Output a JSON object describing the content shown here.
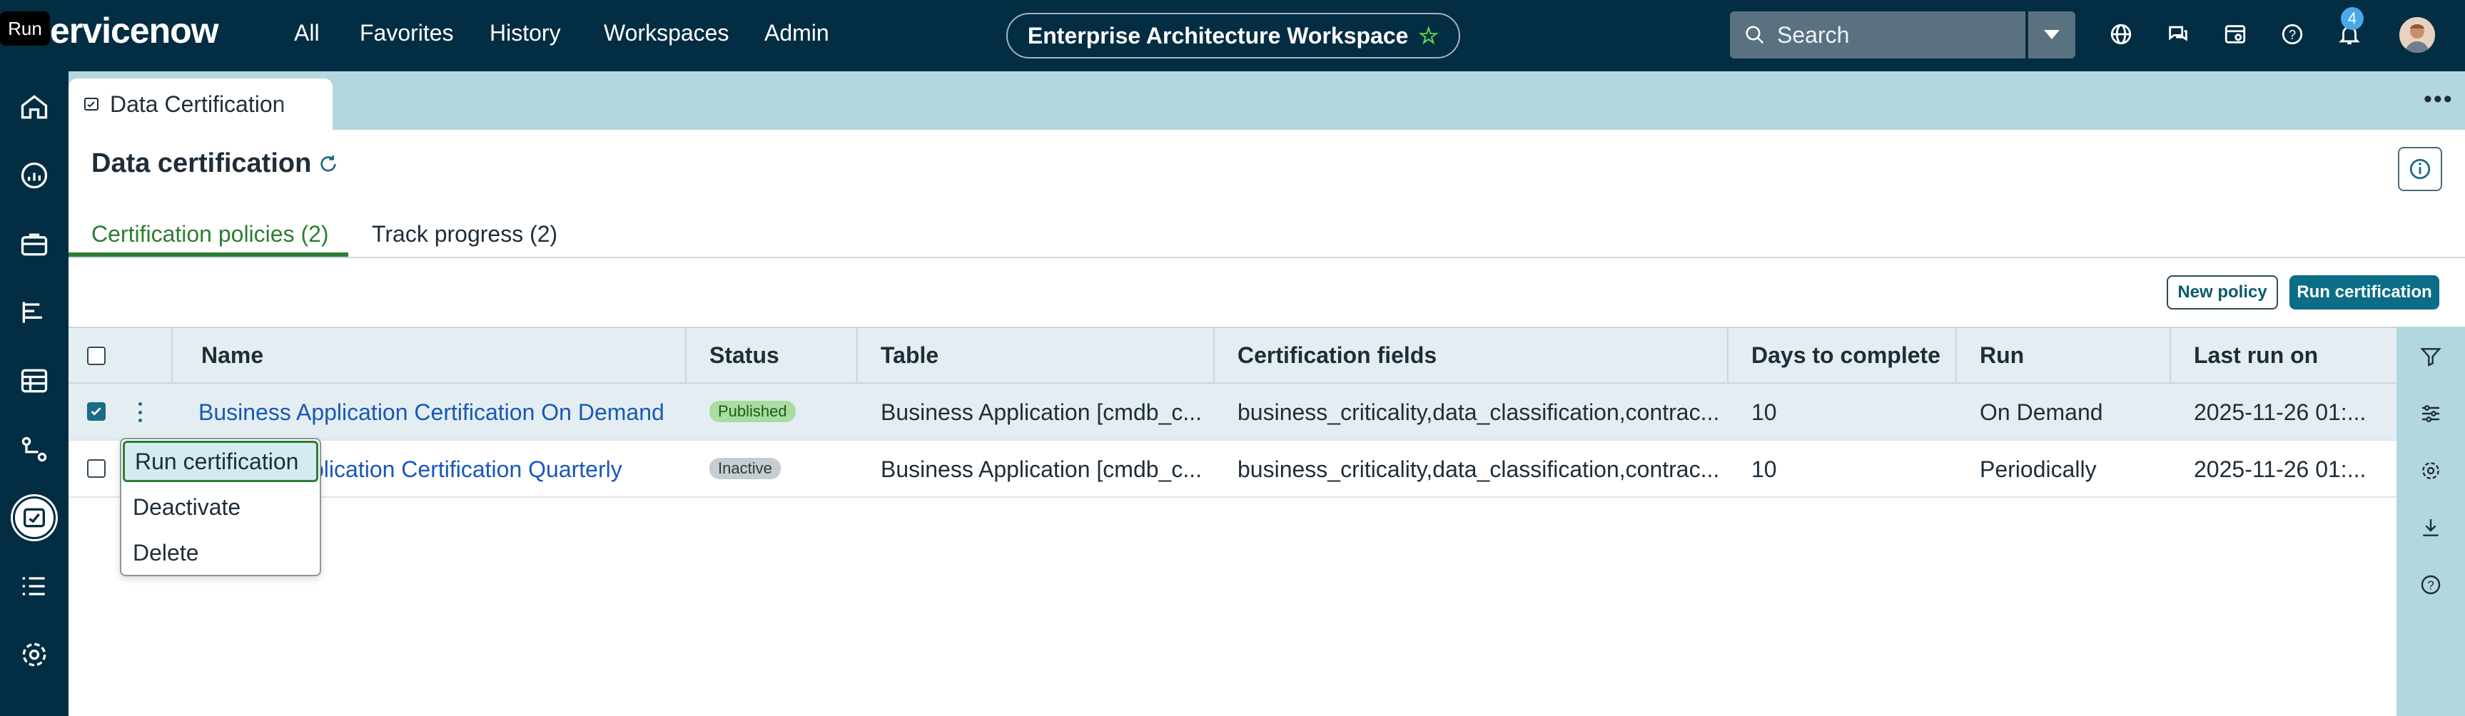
{
  "tooltip": "Run",
  "app": {
    "logo_text": "ervicenow"
  },
  "topnav": {
    "items": [
      "All",
      "Favorites",
      "History",
      "Workspaces",
      "Admin"
    ],
    "workspace_title": "Enterprise Architecture Workspace",
    "search_placeholder": "Search",
    "notification_count": "4"
  },
  "doc_tab": {
    "label": "Data Certification"
  },
  "page": {
    "title": "Data certification"
  },
  "tabs": [
    {
      "label": "Certification policies (2)"
    },
    {
      "label": "Track progress (2)"
    }
  ],
  "actions": {
    "new_policy": "New policy",
    "run_certification": "Run certification"
  },
  "table": {
    "columns": [
      "Name",
      "Status",
      "Table",
      "Certification fields",
      "Days to complete",
      "Run",
      "Last run on"
    ],
    "rows": [
      {
        "name": "Business Application Certification On Demand",
        "status": "Published",
        "table": "Business Application [cmdb_c...",
        "fields": "business_criticality,data_classification,contrac...",
        "days": "10",
        "run": "On Demand",
        "last_run": "2025-11-26 01:...",
        "checked": true
      },
      {
        "name": "Business Application Certification Quarterly",
        "name_visible": "plication Certification Quarterly",
        "status": "Inactive",
        "table": "Business Application [cmdb_c...",
        "fields": "business_criticality,data_classification,contrac...",
        "days": "10",
        "run": "Periodically",
        "last_run": "2025-11-26 01:...",
        "checked": false
      }
    ]
  },
  "context_menu": {
    "items": [
      "Run certification",
      "Deactivate",
      "Delete"
    ]
  },
  "colors": {
    "nav_bg": "#032d42",
    "accent_green": "#2e7d32",
    "link_blue": "#1858b8",
    "primary_button": "#0b6e86",
    "rail_light": "#b3d7df"
  }
}
